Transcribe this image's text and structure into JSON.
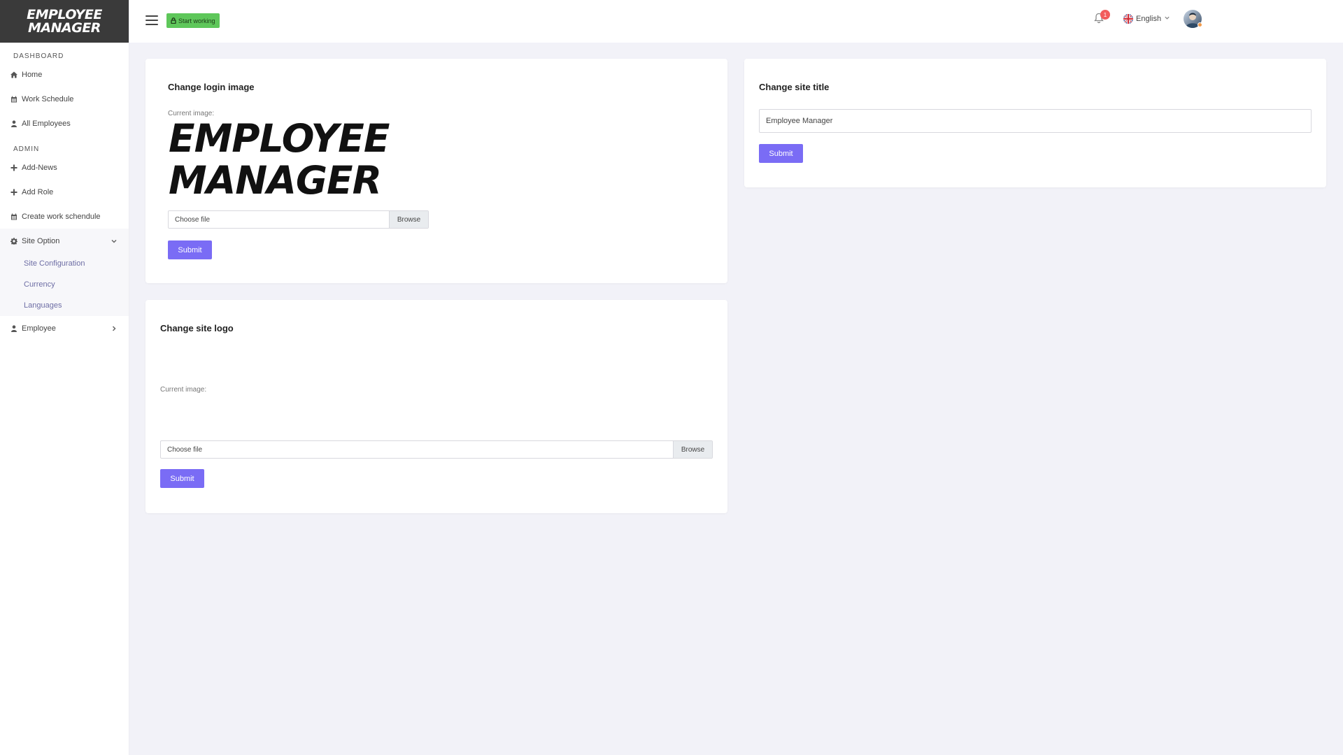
{
  "brand": {
    "line1": "EMPLOYEE",
    "line2": "MANAGER"
  },
  "sidebar": {
    "dashboard_header": "DASHBOARD",
    "dashboard_items": [
      {
        "label": "Home",
        "icon": "home-icon"
      },
      {
        "label": "Work Schedule",
        "icon": "calendar-icon"
      },
      {
        "label": "All Employees",
        "icon": "user-icon"
      }
    ],
    "admin_header": "ADMIN",
    "admin_items": [
      {
        "label": "Add-News",
        "icon": "plus-icon"
      },
      {
        "label": "Add Role",
        "icon": "plus-icon"
      },
      {
        "label": "Create work schendule",
        "icon": "calendar-icon"
      }
    ],
    "site_option": {
      "label": "Site Option",
      "icon": "gear-icon",
      "expanded": true,
      "children": [
        "Site Configuration",
        "Currency",
        "Languages"
      ]
    },
    "employee": {
      "label": "Employee",
      "icon": "user-icon",
      "expanded": false
    }
  },
  "topbar": {
    "start_label": "Start working",
    "notification_count": "1",
    "language": "English"
  },
  "login_card": {
    "title": "Change login image",
    "current_label": "Current image:",
    "image_line1": "EMPLOYEE",
    "image_line2": "MANAGER",
    "file_placeholder": "Choose file",
    "browse_label": "Browse",
    "submit_label": "Submit"
  },
  "title_card": {
    "title": "Change site title",
    "value": "Employee Manager",
    "submit_label": "Submit"
  },
  "logo_card": {
    "title": "Change site logo",
    "current_label": "Current image:",
    "file_placeholder": "Choose file",
    "browse_label": "Browse",
    "submit_label": "Submit"
  },
  "colors": {
    "accent": "#7a6cf5",
    "start_green": "#5ec75a",
    "sidebar_brand_bg": "#3a3a3a",
    "page_bg": "#f2f2f8"
  }
}
